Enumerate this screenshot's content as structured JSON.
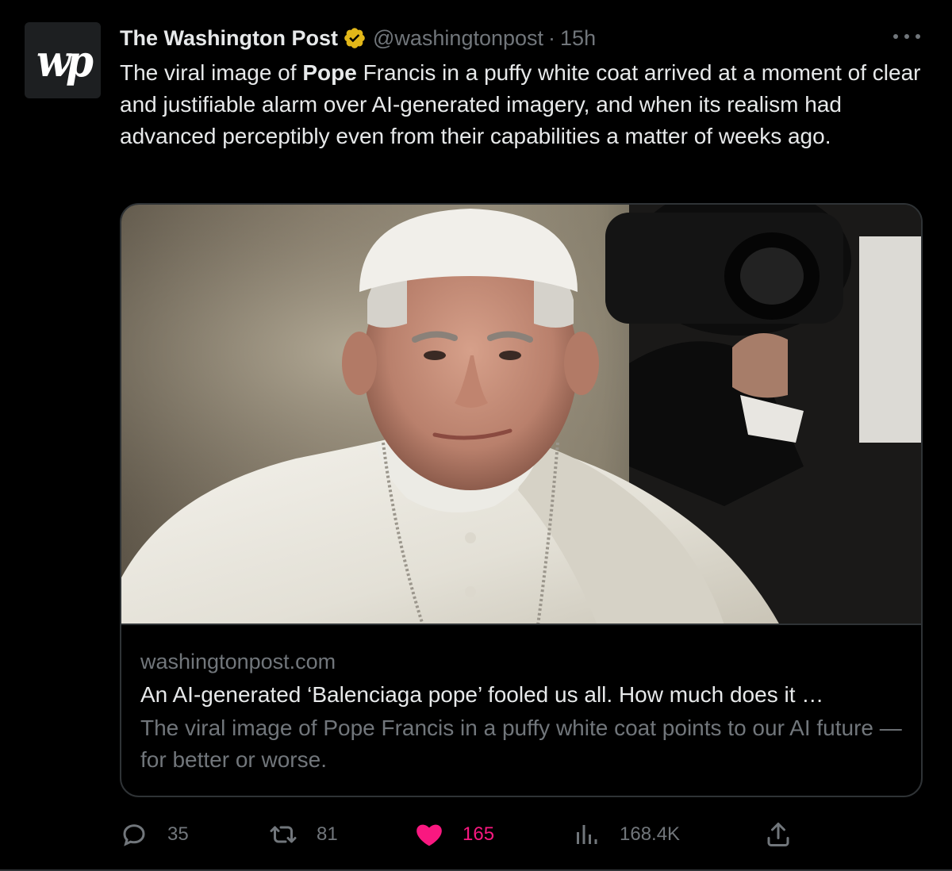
{
  "tweet": {
    "avatar_text": "wp",
    "display_name": "The Washington Post",
    "handle": "@washingtonpost",
    "separator": "·",
    "time": "15h",
    "text_before": "The viral image of ",
    "text_bold": "Pope",
    "text_after": " Francis in a puffy white coat arrived at a moment of clear and justifiable alarm over AI-generated imagery, and when its realism had advanced perceptibly even from their capabilities a matter of weeks ago."
  },
  "card": {
    "domain": "washingtonpost.com",
    "title": "An AI-generated ‘Balenciaga pope’ fooled us all. How much does it …",
    "description": "The viral image of Pope Francis in a puffy white coat points to our AI future — for better or worse."
  },
  "actions": {
    "replies": "35",
    "retweets": "81",
    "likes": "165",
    "views": "168.4K"
  },
  "colors": {
    "background": "#000000",
    "text": "#e7e9ea",
    "muted": "#71767b",
    "border": "#2f3336",
    "like": "#f91880",
    "verified": "#e2b719"
  }
}
